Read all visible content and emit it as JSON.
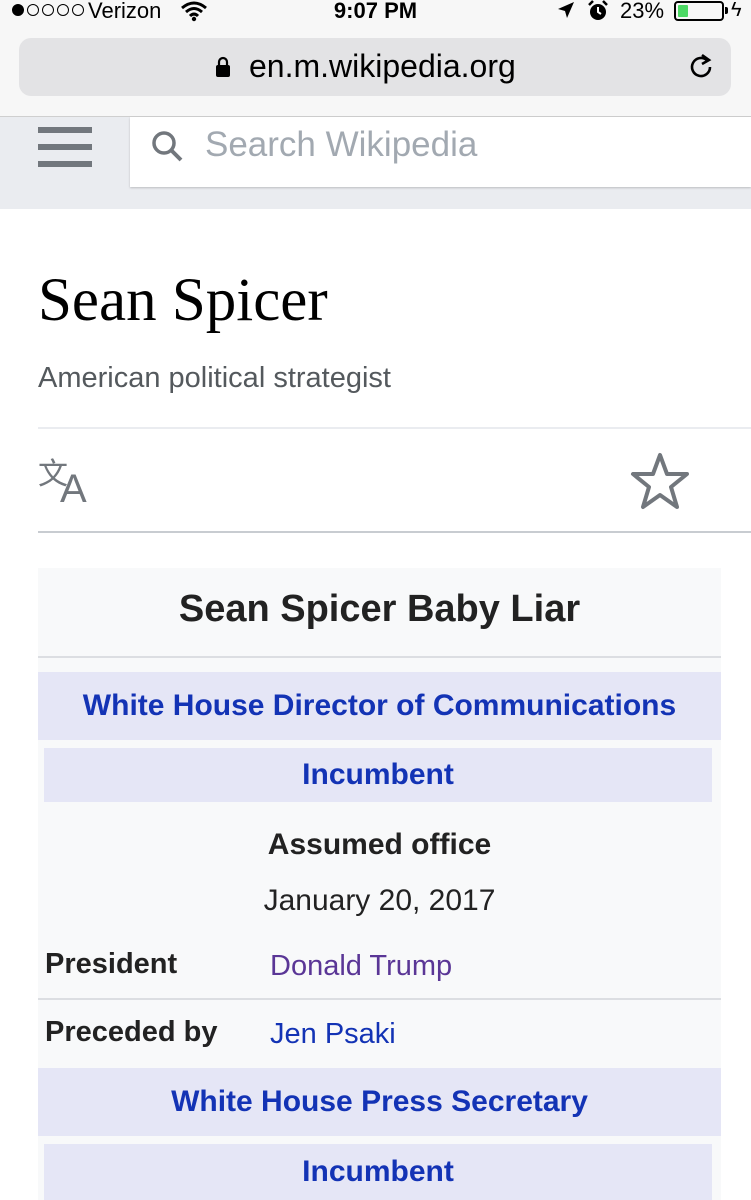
{
  "status_bar": {
    "carrier": "Verizon",
    "time": "9:07 PM",
    "battery_percent": "23%",
    "battery_level": 0.23,
    "signal_bars_filled": 1,
    "signal_bars_total": 5,
    "battery_color": "#4cd964"
  },
  "browser": {
    "url": "en.m.wikipedia.org"
  },
  "wiki_header": {
    "search_placeholder": "Search Wikipedia"
  },
  "article": {
    "title": "Sean Spicer",
    "description": "American political strategist"
  },
  "infobox": {
    "caption": "Sean Spicer Baby Liar",
    "office1": {
      "title": "White House Director of Communications",
      "status": "Incumbent",
      "assumed_label": "Assumed office",
      "assumed_date": "January 20, 2017",
      "president_label": "President",
      "president": "Donald Trump",
      "preceded_label": "Preceded by",
      "preceded": "Jen Psaki"
    },
    "office2": {
      "title": "White House Press Secretary",
      "status": "Incumbent"
    }
  },
  "colors": {
    "link": "#1333b5",
    "visited_link": "#5a3696",
    "band_bg": "#e5e6f6",
    "header_bg": "#eaecf0"
  },
  "icons": {
    "lock": "lock-icon",
    "reload": "reload-icon",
    "menu": "hamburger-menu-icon",
    "search": "search-icon",
    "language": "language-icon",
    "watch": "star-icon"
  }
}
